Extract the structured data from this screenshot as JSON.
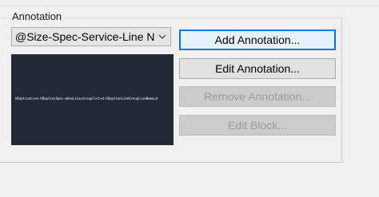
{
  "annotation": {
    "group_title": "Annotation",
    "dropdown": {
      "selected": "@Size-Spec-Service-Line Nu"
    },
    "preview": {
      "text": "hRoptionLine-hRoptionSpec-mAnoLine=Grouplist+d-hRoptionLineGroupLineName=d"
    },
    "buttons": {
      "add": "Add Annotation...",
      "edit": "Edit Annotation...",
      "remove": "Remove Annotation...",
      "edit_block": "Edit Block..."
    }
  }
}
